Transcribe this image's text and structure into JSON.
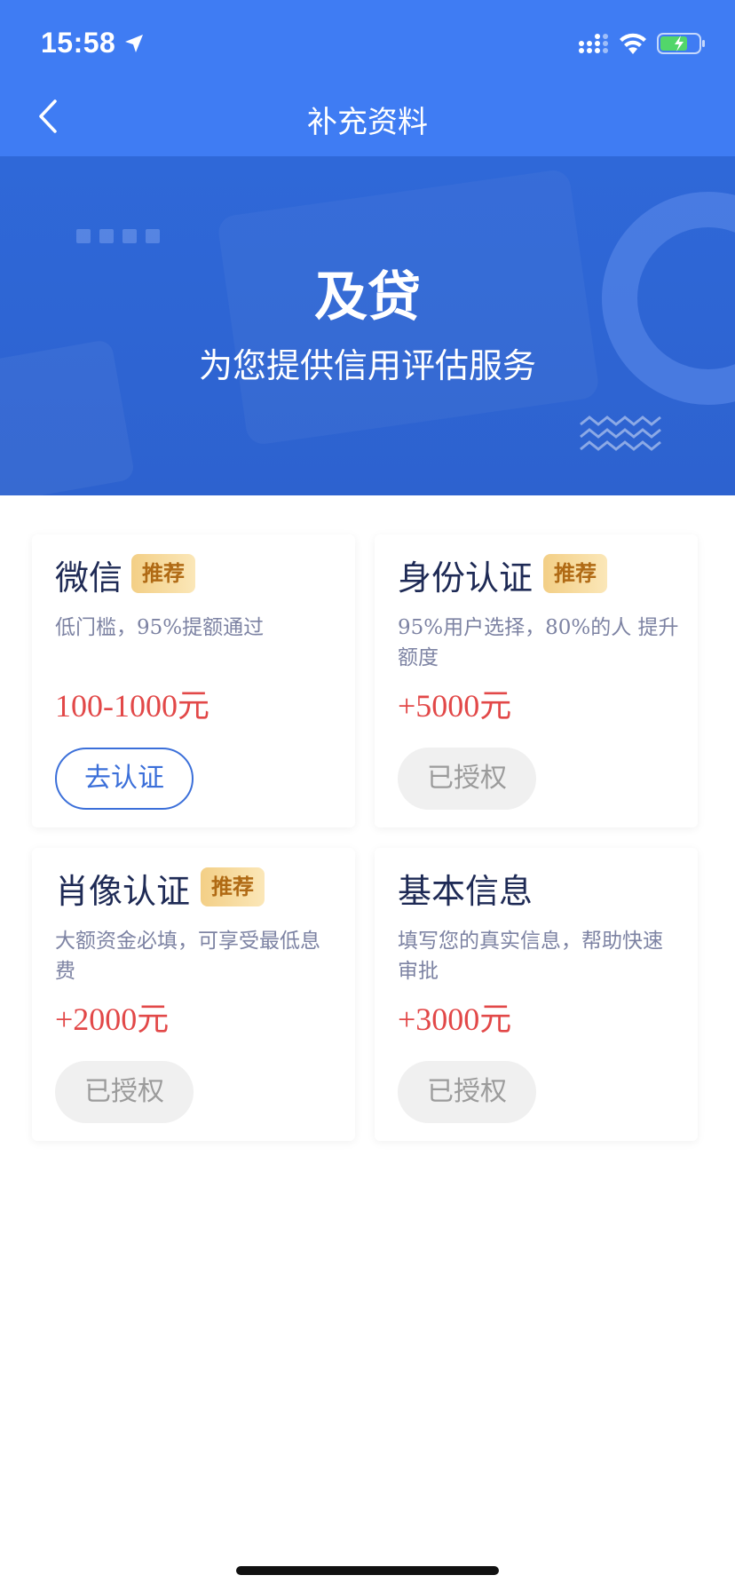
{
  "status_bar": {
    "time": "15:58",
    "icons": [
      "location-arrow-icon",
      "signal-icon",
      "wifi-icon",
      "battery-charging-icon"
    ]
  },
  "nav": {
    "title": "补充资料",
    "back_icon": "chevron-left-icon"
  },
  "banner": {
    "title": "及贷",
    "subtitle": "为您提供信用评估服务"
  },
  "cards": [
    {
      "title": "微信",
      "badge": "推荐",
      "desc": "低门槛，95%提额通过",
      "amount": "100-1000元",
      "button": "去认证",
      "button_state": "primary"
    },
    {
      "title": "身份认证",
      "badge": "推荐",
      "desc": "95%用户选择，80%的人 提升额度",
      "amount": "+5000元",
      "button": "已授权",
      "button_state": "done"
    },
    {
      "title": "肖像认证",
      "badge": "推荐",
      "desc": "大额资金必填，可享受最低息费",
      "amount": "+2000元",
      "button": "已授权",
      "button_state": "done"
    },
    {
      "title": "基本信息",
      "badge": "",
      "desc": "填写您的真实信息，帮助快速审批",
      "amount": "+3000元",
      "button": "已授权",
      "button_state": "done"
    }
  ],
  "colors": {
    "primary": "#3f7cf3",
    "amount": "#e24848",
    "badge_text": "#b06a14"
  }
}
